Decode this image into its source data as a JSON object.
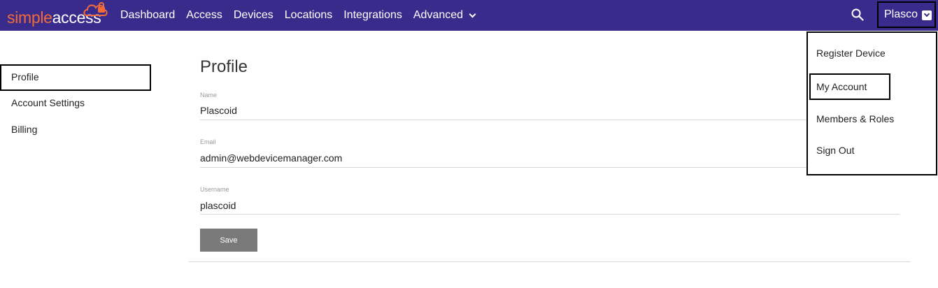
{
  "brand": {
    "part1": "simple",
    "part2": "access",
    "cloud_color": "#f26b3a"
  },
  "colors": {
    "nav_bg": "#382b8c",
    "save_bg": "#7a7a7a"
  },
  "nav": {
    "items": [
      "Dashboard",
      "Access",
      "Devices",
      "Locations",
      "Integrations"
    ],
    "advanced_label": "Advanced",
    "search_icon": "search-icon"
  },
  "user_menu": {
    "name": "Plasco",
    "items": [
      "Register Device",
      "My Account",
      "Members & Roles",
      "Sign Out"
    ],
    "highlighted": "My Account"
  },
  "sidebar": {
    "items": [
      "Profile",
      "Account Settings",
      "Billing"
    ],
    "active": "Profile"
  },
  "profile": {
    "title": "Profile",
    "name_label": "Name",
    "name_value": "Plascoid",
    "email_label": "Email",
    "email_value": "admin@webdevicemanager.com",
    "username_label": "Username",
    "username_value": "plascoid",
    "save_label": "Save"
  }
}
